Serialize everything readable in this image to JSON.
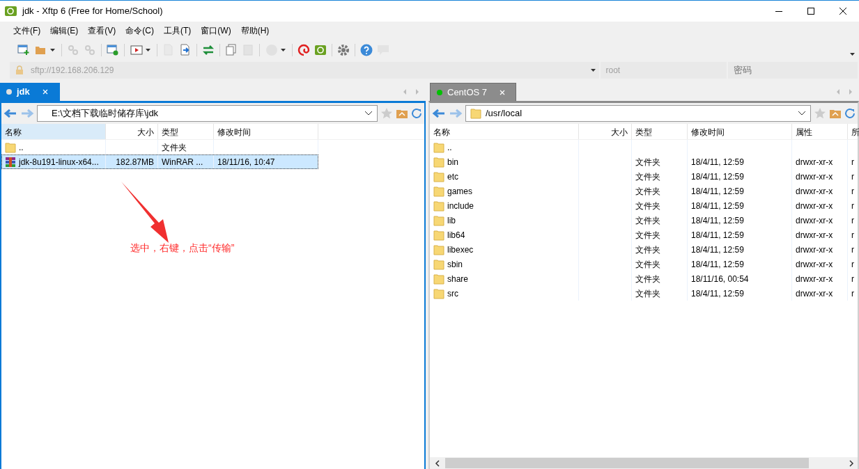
{
  "window": {
    "title": "jdk - Xftp 6 (Free for Home/School)"
  },
  "menu": [
    "文件(F)",
    "编辑(E)",
    "查看(V)",
    "命令(C)",
    "工具(T)",
    "窗口(W)",
    "帮助(H)"
  ],
  "toolbar": [
    {
      "disabled": false
    },
    {
      "disabled": false
    },
    {
      "disabled": true
    },
    {
      "disabled": true
    },
    {
      "disabled": false
    },
    {
      "disabled": false
    },
    {
      "disabled": true
    },
    {
      "disabled": false
    },
    {
      "disabled": false
    },
    {
      "disabled": false
    },
    {
      "disabled": true
    },
    {
      "disabled": true
    },
    {
      "disabled": false
    },
    {
      "disabled": false
    },
    {
      "disabled": false
    },
    {
      "disabled": false
    },
    {
      "disabled": true
    }
  ],
  "address": {
    "url": "sftp://192.168.206.129",
    "user": "root",
    "password_placeholder": "密码"
  },
  "panes": [
    {
      "tab": {
        "label": "jdk",
        "selected": true,
        "color": "#e0e0e0"
      },
      "path": "E:\\文档下载临时储存库\\jdk",
      "path_folder_icon": false,
      "columns": [
        "名称",
        "大小",
        "类型",
        "修改时间"
      ],
      "rows": [
        {
          "kind": "folder",
          "name": "..",
          "size": "",
          "type": "文件夹",
          "modified": "",
          "selected": false
        },
        {
          "kind": "archive",
          "name": "jdk-8u191-linux-x64...",
          "size": "182.87MB",
          "type": "WinRAR ...",
          "modified": "18/11/16, 10:47",
          "selected": true
        }
      ],
      "annotation": "选中，右键，点击“传输”"
    },
    {
      "tab": {
        "label": "CentOS 7",
        "selected": false,
        "color": "#00c000"
      },
      "path": "/usr/local",
      "path_folder_icon": true,
      "columns": [
        "名称",
        "大小",
        "类型",
        "修改时间",
        "属性",
        "所"
      ],
      "rows": [
        {
          "kind": "folder",
          "name": "..",
          "selected": false
        },
        {
          "kind": "folder",
          "name": "bin",
          "type": "文件夹",
          "modified": "18/4/11, 12:59",
          "attrs": "drwxr-xr-x",
          "owner": "r",
          "selected": false
        },
        {
          "kind": "folder",
          "name": "etc",
          "type": "文件夹",
          "modified": "18/4/11, 12:59",
          "attrs": "drwxr-xr-x",
          "owner": "r",
          "selected": false
        },
        {
          "kind": "folder",
          "name": "games",
          "type": "文件夹",
          "modified": "18/4/11, 12:59",
          "attrs": "drwxr-xr-x",
          "owner": "r",
          "selected": false
        },
        {
          "kind": "folder",
          "name": "include",
          "type": "文件夹",
          "modified": "18/4/11, 12:59",
          "attrs": "drwxr-xr-x",
          "owner": "r",
          "selected": false
        },
        {
          "kind": "folder",
          "name": "lib",
          "type": "文件夹",
          "modified": "18/4/11, 12:59",
          "attrs": "drwxr-xr-x",
          "owner": "r",
          "selected": false
        },
        {
          "kind": "folder",
          "name": "lib64",
          "type": "文件夹",
          "modified": "18/4/11, 12:59",
          "attrs": "drwxr-xr-x",
          "owner": "r",
          "selected": false
        },
        {
          "kind": "folder",
          "name": "libexec",
          "type": "文件夹",
          "modified": "18/4/11, 12:59",
          "attrs": "drwxr-xr-x",
          "owner": "r",
          "selected": false
        },
        {
          "kind": "folder",
          "name": "sbin",
          "type": "文件夹",
          "modified": "18/4/11, 12:59",
          "attrs": "drwxr-xr-x",
          "owner": "r",
          "selected": false
        },
        {
          "kind": "folder",
          "name": "share",
          "type": "文件夹",
          "modified": "18/11/16, 00:54",
          "attrs": "drwxr-xr-x",
          "owner": "r",
          "selected": false
        },
        {
          "kind": "folder",
          "name": "src",
          "type": "文件夹",
          "modified": "18/4/11, 12:59",
          "attrs": "drwxr-xr-x",
          "owner": "r",
          "selected": false
        }
      ]
    }
  ]
}
